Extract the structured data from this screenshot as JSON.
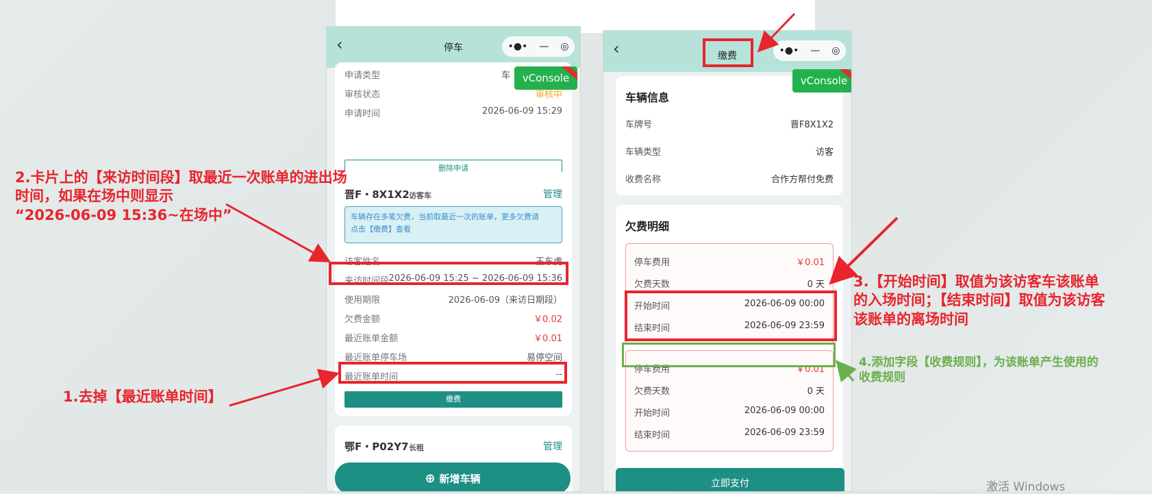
{
  "phone1": {
    "nav": {
      "title": "停车",
      "back": "‹",
      "capsule": [
        "•●•",
        "—",
        "◎"
      ]
    },
    "vconsole": {
      "label": "vConsole"
    },
    "card1": {
      "rows": [
        {
          "k": "申请类型",
          "v": "车"
        },
        {
          "k": "审核状态",
          "v": "审核中"
        },
        {
          "k": "申请时间",
          "v": "2026-06-09 15:29"
        }
      ],
      "button": "删除申请"
    },
    "card2": {
      "plate": "晋F・8X1X2",
      "tag": "访客车",
      "manage": "管理",
      "notice_line1": "车辆存在多笔欠费，当前取最近一次的账单，更多欠费请",
      "notice_line2": "点击【缴费】查看",
      "rows": [
        {
          "k": "访客姓名",
          "v": "王东虎"
        },
        {
          "k": "来访时间段",
          "v": "2026-06-09 15:25 ~ 2026-06-09 15:36"
        },
        {
          "k": "使用期限",
          "v": "2026-06-09（来访日期段）"
        },
        {
          "k": "欠费金额",
          "v": "￥0.02"
        },
        {
          "k": "最近账单金额",
          "v": "￥0.01"
        },
        {
          "k": "最近账单停车场",
          "v": "易停空间"
        },
        {
          "k": "最近账单时间",
          "v": "--"
        }
      ],
      "button": "缴费"
    },
    "card3": {
      "plate": "鄂F・P02Y7",
      "tag": "长租",
      "manage": "管理"
    },
    "add_button": "新增车辆"
  },
  "phone2": {
    "nav": {
      "title": "缴费",
      "back": "‹",
      "capsule": [
        "•●•",
        "—",
        "◎"
      ]
    },
    "vconsole": {
      "label": "vConsole"
    },
    "vehicle": {
      "title": "车辆信息",
      "rows": [
        {
          "k": "车牌号",
          "v": "晋F8X1X2"
        },
        {
          "k": "车辆类型",
          "v": "访客"
        },
        {
          "k": "收费名称",
          "v": "合作方帮付免费"
        }
      ]
    },
    "fees": {
      "title": "欠费明细",
      "items": [
        {
          "rows": [
            {
              "k": "停车费用",
              "v": "￥0.01"
            },
            {
              "k": "欠费天数",
              "v": "0 天"
            },
            {
              "k": "开始时间",
              "v": "2026-06-09 00:00"
            },
            {
              "k": "结束时间",
              "v": "2026-06-09 23:59"
            }
          ]
        },
        {
          "rows": [
            {
              "k": "停车费用",
              "v": "￥0.01"
            },
            {
              "k": "欠费天数",
              "v": "0 天"
            },
            {
              "k": "开始时间",
              "v": "2026-06-09 00:00"
            },
            {
              "k": "结束时间",
              "v": "2026-06-09 23:59"
            }
          ]
        }
      ]
    },
    "pay_button": "立即支付"
  },
  "annotations": {
    "a2_line1": "2.卡片上的【来访时间段】取最近一次账单的进出场",
    "a2_line2": "时间，如果在场中则显示",
    "a2_line3": "“2026-06-09 15:36~在场中”",
    "a1": "1.去掉【最近账单时间】",
    "a3_line1": "3.【开始时间】取值为该访客车该账单",
    "a3_line2": "的入场时间；【结束时间】取值为该访客",
    "a3_line3": "该账单的离场时间",
    "a4_line1": "4.添加字段【收费规则】，为该账单产生使用的",
    "a4_line2": "收费规则"
  },
  "watermark": "激活 Windows",
  "colors": {
    "accent": "#1e8f84",
    "nav": "#b6e2da",
    "annotation_red": "#e8242d",
    "annotation_green": "#6ab04c"
  }
}
